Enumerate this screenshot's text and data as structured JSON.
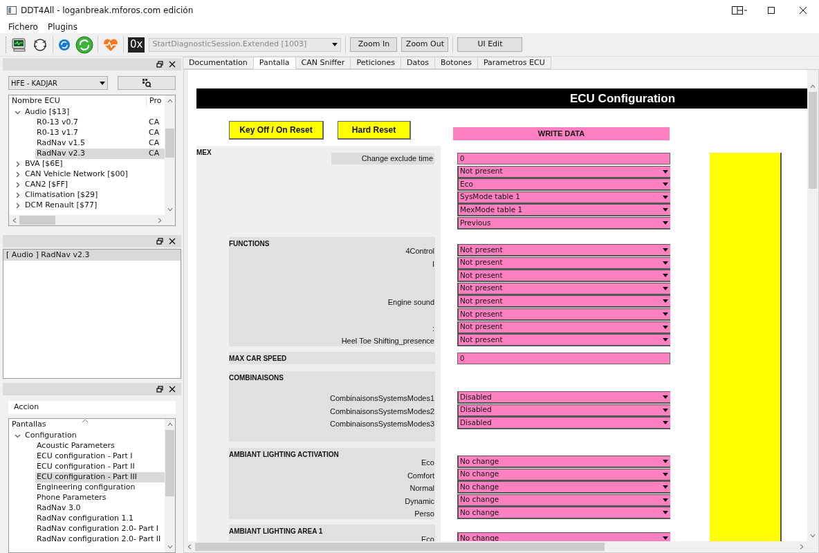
{
  "window": {
    "title": "DDT4All - loganbreak.mforos.com edición"
  },
  "menu": [
    "Fichero",
    "Plugins"
  ],
  "toolbar": {
    "hex_label": "0x",
    "request_combo": {
      "value": "StartDiagnosticSession.Extended [1003]",
      "disabled": true
    },
    "buttons": [
      "Zoom In",
      "Zoom Out",
      "UI Edit"
    ]
  },
  "ecu_panel": {
    "vehicle_combo": "HFE - KADJAR",
    "columns": [
      "Nombre ECU",
      "Pro"
    ],
    "tree": [
      {
        "label": "Audio [$13]",
        "expanded": true,
        "selected": false,
        "children": [
          {
            "label": "R0-13 v0.7",
            "protocol": "CA",
            "selected": false
          },
          {
            "label": "R0-13 v1.7",
            "protocol": "CA",
            "selected": false
          },
          {
            "label": "RadNav v1.5",
            "protocol": "CA",
            "selected": false
          },
          {
            "label": "RadNav v2.3",
            "protocol": "CA",
            "selected": true
          }
        ]
      },
      {
        "label": "BVA [$6E]",
        "expanded": false,
        "selected": false
      },
      {
        "label": "CAN Vehicle Network [$00]",
        "expanded": false,
        "selected": false
      },
      {
        "label": "CAN2 [$FF]",
        "expanded": false,
        "selected": false
      },
      {
        "label": "Climatisation [$29]",
        "expanded": false,
        "selected": false
      },
      {
        "label": "DCM Renault [$77]",
        "expanded": false,
        "selected": false
      }
    ]
  },
  "ecu_list": [
    {
      "label": "[ Audio ] RadNav v2.3",
      "selected": true
    }
  ],
  "screens_panel": {
    "action_field": "Accion",
    "header": "Pantallas",
    "tree": [
      {
        "label": "Configuration",
        "expanded": true,
        "selected": false,
        "children": [
          {
            "label": "Acoustic Parameters",
            "selected": false
          },
          {
            "label": "ECU configuration - Part I",
            "selected": false
          },
          {
            "label": "ECU configuration - Part II",
            "selected": false
          },
          {
            "label": "ECU configuration - Part III",
            "selected": true
          },
          {
            "label": "Engineering configuration",
            "selected": false
          },
          {
            "label": "Phone Parameters",
            "selected": false
          },
          {
            "label": "RadNav 3.0",
            "selected": false
          },
          {
            "label": "RadNav configuration 1.1",
            "selected": false
          },
          {
            "label": "RadNav configuration 2.0- Part I",
            "selected": false
          },
          {
            "label": "RadNav configuration 2.0- Part II",
            "selected": false
          }
        ]
      }
    ]
  },
  "tabs": [
    {
      "label": "Documentation",
      "selected": false
    },
    {
      "label": "Pantalla",
      "selected": true
    },
    {
      "label": "CAN Sniffer",
      "selected": false
    },
    {
      "label": "Peticiones",
      "selected": false
    },
    {
      "label": "Datos",
      "selected": false
    },
    {
      "label": "Botones",
      "selected": false
    },
    {
      "label": "Parametros ECU",
      "selected": false
    }
  ],
  "screen": {
    "title": "ECU Configuration",
    "buttons": [
      "Key Off / On Reset",
      "Hard Reset"
    ],
    "write_button": "WRITE DATA",
    "sections": [
      {
        "title": "MEX",
        "rows": [
          {
            "label": "Change exclude time",
            "kind": "field",
            "value": "0"
          },
          {
            "kind": "combo",
            "value": "Not present"
          },
          {
            "kind": "combo",
            "value": "Eco"
          },
          {
            "kind": "combo",
            "value": "SysMode table 1"
          },
          {
            "kind": "combo",
            "value": "MexMode table 1"
          },
          {
            "kind": "combo",
            "value": "Previous"
          }
        ]
      },
      {
        "title": "FUNCTIONS",
        "rows": [
          {
            "label": "4Control",
            "kind": "combo",
            "value": "Not present"
          },
          {
            "label": "I",
            "kind": "combo",
            "value": "Not present"
          },
          {
            "kind": "combo",
            "value": "Not present"
          },
          {
            "kind": "combo",
            "value": "Not present"
          },
          {
            "label": "Engine sound",
            "kind": "combo",
            "value": "Not present"
          },
          {
            "kind": "combo",
            "value": "Not present"
          },
          {
            "label": ":",
            "kind": "combo",
            "value": "Not present"
          },
          {
            "label": "Heel Toe Shifting_presence",
            "kind": "combo",
            "value": "Not present"
          }
        ]
      },
      {
        "title": "MAX CAR SPEED",
        "rows": [
          {
            "kind": "field",
            "value": "0"
          }
        ]
      },
      {
        "title": "COMBINAISONS",
        "rows": [
          {
            "label": "CombinaisonsSystemsModes1",
            "kind": "combo",
            "value": "Disabled"
          },
          {
            "label": "CombinaisonsSystemsModes2",
            "kind": "combo",
            "value": "Disabled"
          },
          {
            "label": "CombinaisonsSystemsModes3",
            "kind": "combo",
            "value": "Disabled"
          }
        ]
      },
      {
        "title": "AMBIANT LIGHTING ACTIVATION",
        "rows": [
          {
            "label": "Eco",
            "kind": "combo",
            "value": "No change"
          },
          {
            "label": "Comfort",
            "kind": "combo",
            "value": "No change"
          },
          {
            "label": "Normal",
            "kind": "combo",
            "value": "No change"
          },
          {
            "label": "Dynamic",
            "kind": "combo",
            "value": "No change"
          },
          {
            "label": "Perso",
            "kind": "combo",
            "value": "No change"
          }
        ]
      },
      {
        "title": "AMBIANT LIGHTING AREA 1",
        "rows": [
          {
            "label": "Eco",
            "kind": "combo",
            "value": "No change"
          }
        ]
      }
    ]
  }
}
